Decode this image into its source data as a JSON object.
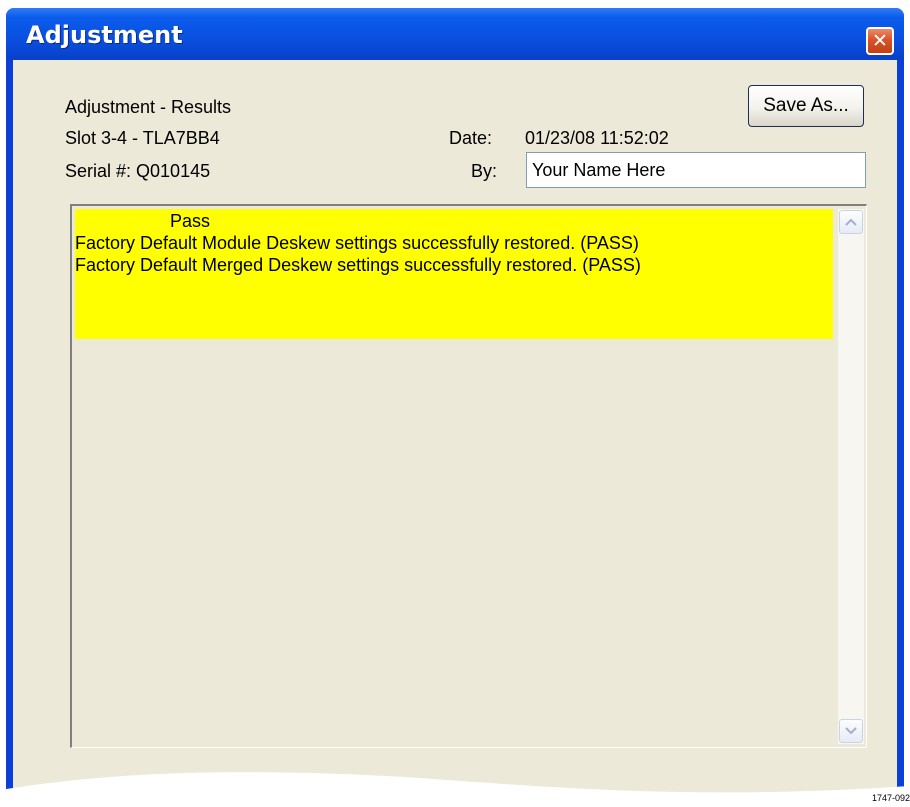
{
  "window": {
    "title": "Adjustment",
    "close_glyph": "✕"
  },
  "header": {
    "heading": "Adjustment - Results",
    "slot": "Slot 3-4 - TLA7BB4",
    "serial": "Serial #: Q010145",
    "date_label": "Date:",
    "date_value": "01/23/08 11:52:02",
    "by_label": "By:",
    "by_value": "Your Name Here"
  },
  "toolbar": {
    "save_as_label": "Save As..."
  },
  "results": {
    "status": "Pass",
    "lines": [
      "Factory Default Module Deskew settings successfully restored. (PASS)",
      "Factory Default Merged Deskew settings successfully restored. (PASS)"
    ],
    "highlight_color": "#ffff00"
  },
  "scrollbar": {
    "up_icon": "chevron-up-icon",
    "down_icon": "chevron-down-icon"
  },
  "figure_id": "1747-092",
  "colors": {
    "title_bar": "#0a4fe0",
    "dialog_face": "#ece9d8",
    "close_button": "#d9542b"
  }
}
